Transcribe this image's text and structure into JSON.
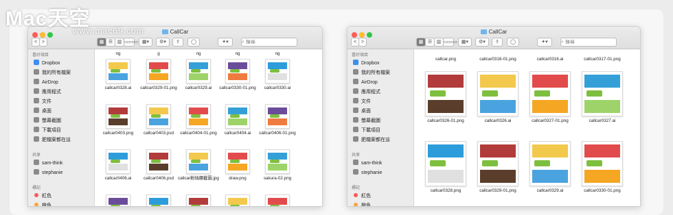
{
  "watermark": {
    "logo": "Mac天空",
    "url": "www.mac69.com"
  },
  "colors": {
    "close": "#fc5c56",
    "minimize": "#fdbb2d",
    "zoom": "#35c648",
    "tag_red": "#fc5a55",
    "tag_orange": "#f9a435",
    "accent": "#6fb6ef"
  },
  "left_window": {
    "title": "CallCar",
    "search_placeholder": "搜尋",
    "toolbar": {
      "back": "<",
      "forward": ">",
      "view_icon": "▦",
      "view_list": "☰",
      "view_column": "▥",
      "view_cover": "▭▭▭",
      "arrange": "▦▾",
      "action": "⚙▾",
      "share": "⇪",
      "tag": "◯",
      "dropbox": "✦▾"
    },
    "sidebar": {
      "favorites_label": "喜好項目",
      "favorites": [
        "Dropbox",
        "我的所有檔案",
        "AirDrop",
        "應用程式",
        "文件",
        "桌面",
        "螢幕截圖",
        "下載項目",
        "肥檔案都在這"
      ],
      "shared_label": "共享",
      "shared": [
        "sam-think",
        "stephanie"
      ],
      "tags_label": "標記",
      "tags": [
        "紅色",
        "橙色"
      ]
    },
    "top_partial": [
      "ng",
      "g",
      "ng",
      "ng",
      "ng"
    ],
    "files": [
      [
        "callcar0328.ai",
        "callcar0329-01.png",
        "callcar0329.ai",
        "callcar0330-01.png",
        "callcar0330.ai"
      ],
      [
        "callcar0403.png",
        "callcar0403.psd",
        "callcar0404-01.png",
        "callcar0404.ai",
        "callcar0406-01.png"
      ],
      [
        "callcar0406.ai",
        "callcar0406.psd",
        "callcar粉絲團截圖.jpg",
        "draw.png",
        "sakura-02.png"
      ],
      [
        "",
        "",
        "",
        "",
        ""
      ]
    ]
  },
  "right_window": {
    "title": "CallCar",
    "search_placeholder": "搜尋",
    "toolbar": {
      "back": "<",
      "forward": ">",
      "view_icon": "▦",
      "view_list": "☰",
      "view_column": "▥",
      "view_cover": "▭▭▭",
      "arrange": "▦▾",
      "action": "⚙▾",
      "share": "⇪",
      "tag": "◯",
      "dropbox": "✦▾"
    },
    "sidebar": {
      "favorites_label": "喜好項目",
      "favorites": [
        "Dropbox",
        "我的所有檔案",
        "AirDrop",
        "應用程式",
        "文件",
        "桌面",
        "螢幕截圖",
        "下載項目",
        "肥檔案都在這"
      ],
      "shared_label": "共享",
      "shared": [
        "sam-think",
        "stephanie"
      ],
      "tags_label": "標記",
      "tags": [
        "紅色",
        "橙色"
      ]
    },
    "files": [
      [
        "callcar.png",
        "callcar0316-01.png",
        "callcar0316.ai",
        "callcar0317-01.png"
      ],
      [
        "callcar0326-01.png",
        "callcar0326.ai",
        "callcar0327-01.png",
        "callcar0327.ai"
      ],
      [
        "callcar0328.png",
        "callcar0329-01.png",
        "callcar0329.ai",
        "callcar0330-01.png"
      ]
    ]
  }
}
